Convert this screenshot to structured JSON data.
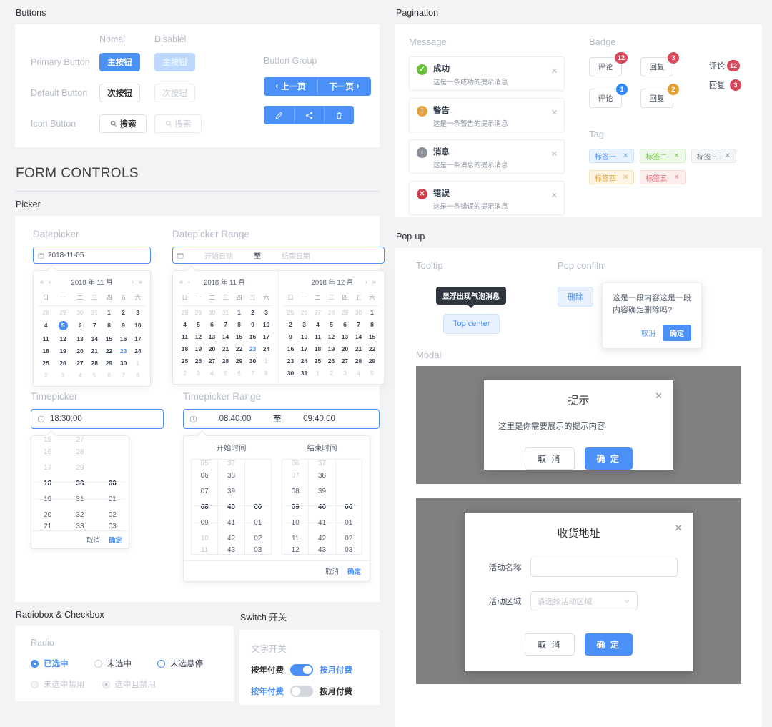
{
  "sections": {
    "buttons": "Buttons",
    "form_controls": "FORM CONTROLS",
    "picker": "Picker",
    "radio_checkbox": "Radiobox & Checkbox",
    "switch": "Switch 开关",
    "pagination": "Pagination",
    "popup": "Pop-up"
  },
  "buttons": {
    "col_normal": "Nomal",
    "col_disabled": "Disablel",
    "row_primary": "Primary Button",
    "row_default": "Default Button",
    "row_icon": "Icon Button",
    "primary_label": "主按钮",
    "default_label": "次按钮",
    "icon_label": "搜索",
    "group_title": "Button Group",
    "prev_page": "上一页",
    "next_page": "下一页",
    "icon_edit": "edit-icon",
    "icon_share": "share-icon",
    "icon_delete": "delete-icon"
  },
  "picker": {
    "datepicker_label": "Datepicker",
    "datepicker_value": "2018-11-05",
    "range_label": "Datepicker Range",
    "range_start_ph": "开始日期",
    "range_sep": "至",
    "range_end_ph": "结束日期",
    "cal_nov": "2018 年 11 月",
    "cal_dec": "2018 年 12 月",
    "weekdays": [
      "日",
      "一",
      "二",
      "三",
      "四",
      "五",
      "六"
    ],
    "nov_weeks": [
      [
        {
          "d": "28",
          "s": "mut"
        },
        {
          "d": "29",
          "s": "mut"
        },
        {
          "d": "30",
          "s": "mut"
        },
        {
          "d": "31",
          "s": "mut"
        },
        {
          "d": "1",
          "s": ""
        },
        {
          "d": "2",
          "s": ""
        },
        {
          "d": "3",
          "s": ""
        }
      ],
      [
        {
          "d": "4",
          "s": ""
        },
        {
          "d": "5",
          "s": "sel"
        },
        {
          "d": "6",
          "s": ""
        },
        {
          "d": "7",
          "s": ""
        },
        {
          "d": "8",
          "s": ""
        },
        {
          "d": "9",
          "s": ""
        },
        {
          "d": "10",
          "s": ""
        }
      ],
      [
        {
          "d": "11",
          "s": ""
        },
        {
          "d": "12",
          "s": ""
        },
        {
          "d": "13",
          "s": ""
        },
        {
          "d": "14",
          "s": ""
        },
        {
          "d": "15",
          "s": ""
        },
        {
          "d": "16",
          "s": ""
        },
        {
          "d": "17",
          "s": ""
        }
      ],
      [
        {
          "d": "18",
          "s": ""
        },
        {
          "d": "19",
          "s": ""
        },
        {
          "d": "20",
          "s": ""
        },
        {
          "d": "21",
          "s": ""
        },
        {
          "d": "22",
          "s": ""
        },
        {
          "d": "23",
          "s": "today"
        },
        {
          "d": "24",
          "s": ""
        }
      ],
      [
        {
          "d": "25",
          "s": ""
        },
        {
          "d": "26",
          "s": ""
        },
        {
          "d": "27",
          "s": ""
        },
        {
          "d": "28",
          "s": ""
        },
        {
          "d": "29",
          "s": ""
        },
        {
          "d": "30",
          "s": ""
        },
        {
          "d": "1",
          "s": "mut"
        }
      ],
      [
        {
          "d": "2",
          "s": "mut"
        },
        {
          "d": "3",
          "s": "mut"
        },
        {
          "d": "4",
          "s": "mut"
        },
        {
          "d": "5",
          "s": "mut"
        },
        {
          "d": "6",
          "s": "mut"
        },
        {
          "d": "7",
          "s": "mut"
        },
        {
          "d": "8",
          "s": "mut"
        }
      ]
    ],
    "nov_range_weeks": [
      [
        {
          "d": "28",
          "s": "mut"
        },
        {
          "d": "29",
          "s": "mut"
        },
        {
          "d": "30",
          "s": "mut"
        },
        {
          "d": "31",
          "s": "mut"
        },
        {
          "d": "1",
          "s": ""
        },
        {
          "d": "2",
          "s": ""
        },
        {
          "d": "3",
          "s": ""
        }
      ],
      [
        {
          "d": "4",
          "s": ""
        },
        {
          "d": "5",
          "s": ""
        },
        {
          "d": "6",
          "s": ""
        },
        {
          "d": "7",
          "s": ""
        },
        {
          "d": "8",
          "s": ""
        },
        {
          "d": "9",
          "s": ""
        },
        {
          "d": "10",
          "s": ""
        }
      ],
      [
        {
          "d": "11",
          "s": ""
        },
        {
          "d": "12",
          "s": ""
        },
        {
          "d": "13",
          "s": ""
        },
        {
          "d": "14",
          "s": ""
        },
        {
          "d": "15",
          "s": ""
        },
        {
          "d": "16",
          "s": ""
        },
        {
          "d": "17",
          "s": ""
        }
      ],
      [
        {
          "d": "18",
          "s": ""
        },
        {
          "d": "19",
          "s": ""
        },
        {
          "d": "20",
          "s": ""
        },
        {
          "d": "21",
          "s": ""
        },
        {
          "d": "22",
          "s": ""
        },
        {
          "d": "23",
          "s": "today"
        },
        {
          "d": "24",
          "s": ""
        }
      ],
      [
        {
          "d": "25",
          "s": ""
        },
        {
          "d": "26",
          "s": ""
        },
        {
          "d": "27",
          "s": ""
        },
        {
          "d": "28",
          "s": ""
        },
        {
          "d": "29",
          "s": ""
        },
        {
          "d": "30",
          "s": ""
        },
        {
          "d": "1",
          "s": "mut"
        }
      ],
      [
        {
          "d": "2",
          "s": "mut"
        },
        {
          "d": "3",
          "s": "mut"
        },
        {
          "d": "4",
          "s": "mut"
        },
        {
          "d": "5",
          "s": "mut"
        },
        {
          "d": "6",
          "s": "mut"
        },
        {
          "d": "7",
          "s": "mut"
        },
        {
          "d": "8",
          "s": "mut"
        }
      ]
    ],
    "dec_weeks": [
      [
        {
          "d": "25",
          "s": "mut"
        },
        {
          "d": "26",
          "s": "mut"
        },
        {
          "d": "27",
          "s": "mut"
        },
        {
          "d": "28",
          "s": "mut"
        },
        {
          "d": "29",
          "s": "mut"
        },
        {
          "d": "30",
          "s": "mut"
        },
        {
          "d": "1",
          "s": ""
        }
      ],
      [
        {
          "d": "2",
          "s": ""
        },
        {
          "d": "3",
          "s": ""
        },
        {
          "d": "4",
          "s": ""
        },
        {
          "d": "5",
          "s": ""
        },
        {
          "d": "6",
          "s": ""
        },
        {
          "d": "7",
          "s": ""
        },
        {
          "d": "8",
          "s": ""
        }
      ],
      [
        {
          "d": "9",
          "s": ""
        },
        {
          "d": "10",
          "s": ""
        },
        {
          "d": "11",
          "s": ""
        },
        {
          "d": "12",
          "s": ""
        },
        {
          "d": "13",
          "s": ""
        },
        {
          "d": "14",
          "s": ""
        },
        {
          "d": "15",
          "s": ""
        }
      ],
      [
        {
          "d": "16",
          "s": ""
        },
        {
          "d": "17",
          "s": ""
        },
        {
          "d": "18",
          "s": ""
        },
        {
          "d": "19",
          "s": ""
        },
        {
          "d": "20",
          "s": ""
        },
        {
          "d": "21",
          "s": ""
        },
        {
          "d": "22",
          "s": ""
        }
      ],
      [
        {
          "d": "23",
          "s": ""
        },
        {
          "d": "24",
          "s": ""
        },
        {
          "d": "25",
          "s": ""
        },
        {
          "d": "26",
          "s": ""
        },
        {
          "d": "27",
          "s": ""
        },
        {
          "d": "28",
          "s": ""
        },
        {
          "d": "29",
          "s": ""
        }
      ],
      [
        {
          "d": "30",
          "s": ""
        },
        {
          "d": "31",
          "s": ""
        },
        {
          "d": "1",
          "s": "mut"
        },
        {
          "d": "2",
          "s": "mut"
        },
        {
          "d": "3",
          "s": "mut"
        },
        {
          "d": "4",
          "s": "mut"
        },
        {
          "d": "5",
          "s": "mut"
        }
      ]
    ],
    "timepicker_label": "Timepicker",
    "timepicker_value": "18:30:00",
    "time_hours": [
      {
        "v": "15",
        "s": "mut part"
      },
      {
        "v": "16",
        "s": "mut"
      },
      {
        "v": "17",
        "s": "mut"
      },
      {
        "v": "18",
        "s": "cur"
      },
      {
        "v": "19",
        "s": ""
      },
      {
        "v": "20",
        "s": ""
      },
      {
        "v": "21",
        "s": "part"
      }
    ],
    "time_minutes": [
      {
        "v": "27",
        "s": "mut part"
      },
      {
        "v": "28",
        "s": "mut"
      },
      {
        "v": "29",
        "s": "mut"
      },
      {
        "v": "30",
        "s": "cur"
      },
      {
        "v": "31",
        "s": ""
      },
      {
        "v": "32",
        "s": ""
      },
      {
        "v": "33",
        "s": "part"
      }
    ],
    "time_seconds": [
      {
        "v": "",
        "s": "part"
      },
      {
        "v": "",
        "s": ""
      },
      {
        "v": "",
        "s": ""
      },
      {
        "v": "00",
        "s": "cur"
      },
      {
        "v": "01",
        "s": ""
      },
      {
        "v": "02",
        "s": ""
      },
      {
        "v": "03",
        "s": "part"
      }
    ],
    "cancel": "取消",
    "confirm": "确定",
    "timerange_label": "Timepicker Range",
    "timerange_start": "08:40:00",
    "timerange_sep": "至",
    "timerange_end": "09:40:00",
    "start_time_title": "开始时间",
    "end_time_title": "结束时间",
    "start_hours": [
      {
        "v": "05",
        "s": "mut part"
      },
      {
        "v": "06",
        "s": ""
      },
      {
        "v": "07",
        "s": ""
      },
      {
        "v": "08",
        "s": "cur"
      },
      {
        "v": "09",
        "s": ""
      },
      {
        "v": "10",
        "s": "mut"
      },
      {
        "v": "11",
        "s": "mut part"
      }
    ],
    "start_minutes": [
      {
        "v": "37",
        "s": "mut part"
      },
      {
        "v": "38",
        "s": ""
      },
      {
        "v": "39",
        "s": ""
      },
      {
        "v": "40",
        "s": "cur"
      },
      {
        "v": "41",
        "s": ""
      },
      {
        "v": "42",
        "s": ""
      },
      {
        "v": "43",
        "s": "part"
      }
    ],
    "start_seconds": [
      {
        "v": "",
        "s": "part"
      },
      {
        "v": "",
        "s": ""
      },
      {
        "v": "",
        "s": ""
      },
      {
        "v": "00",
        "s": "cur"
      },
      {
        "v": "01",
        "s": ""
      },
      {
        "v": "02",
        "s": ""
      },
      {
        "v": "03",
        "s": "part"
      }
    ],
    "end_hours": [
      {
        "v": "06",
        "s": "mut part"
      },
      {
        "v": "07",
        "s": "mut"
      },
      {
        "v": "08",
        "s": ""
      },
      {
        "v": "09",
        "s": "cur"
      },
      {
        "v": "10",
        "s": ""
      },
      {
        "v": "11",
        "s": ""
      },
      {
        "v": "12",
        "s": "part"
      }
    ],
    "end_minutes": [
      {
        "v": "37",
        "s": "mut part"
      },
      {
        "v": "38",
        "s": ""
      },
      {
        "v": "39",
        "s": ""
      },
      {
        "v": "40",
        "s": "cur"
      },
      {
        "v": "41",
        "s": ""
      },
      {
        "v": "42",
        "s": ""
      },
      {
        "v": "43",
        "s": "part"
      }
    ],
    "end_seconds": [
      {
        "v": "",
        "s": "part"
      },
      {
        "v": "",
        "s": ""
      },
      {
        "v": "",
        "s": ""
      },
      {
        "v": "00",
        "s": "cur"
      },
      {
        "v": "01",
        "s": ""
      },
      {
        "v": "02",
        "s": ""
      },
      {
        "v": "03",
        "s": "part"
      }
    ]
  },
  "radio": {
    "title": "Radio",
    "options": [
      {
        "label": "已选中",
        "state": "checked"
      },
      {
        "label": "未选中",
        "state": "unchecked"
      },
      {
        "label": "未选悬停",
        "state": "hover"
      },
      {
        "label": "未选中禁用",
        "state": "disabled"
      },
      {
        "label": "选中且禁用",
        "state": "disabled-checked"
      }
    ]
  },
  "switches": {
    "title": "文字开关",
    "items": [
      {
        "left": "按年付费",
        "right": "按月付费",
        "on": true
      },
      {
        "left": "按年付费",
        "right": "按月付费",
        "on": false
      }
    ]
  },
  "message": {
    "title": "Message",
    "items": [
      {
        "type": "success",
        "title": "成功",
        "desc": "这是一条成功的提示消息",
        "color": "#67c23a",
        "glyph": "✓"
      },
      {
        "type": "warning",
        "title": "警告",
        "desc": "这是一条警告的提示消息",
        "color": "#e6a23c",
        "glyph": "!"
      },
      {
        "type": "info",
        "title": "消息",
        "desc": "这是一条消息的提示消息",
        "color": "#8a8f99",
        "glyph": "i"
      },
      {
        "type": "error",
        "title": "错误",
        "desc": "这是一条错误的提示消息",
        "color": "#d73b4a",
        "glyph": "✕"
      }
    ]
  },
  "badge": {
    "title": "Badge",
    "buttons": [
      {
        "label": "评论",
        "count": "12",
        "color": "#d9485b"
      },
      {
        "label": "回复",
        "count": "3",
        "color": "#d9485b"
      },
      {
        "label": "评论",
        "count": "1",
        "color": "#2f86f6"
      },
      {
        "label": "回复",
        "count": "2",
        "color": "#e0a033"
      }
    ],
    "texts": [
      {
        "label": "评论",
        "count": "12",
        "color": "#d9485b"
      },
      {
        "label": "回复",
        "count": "3",
        "color": "#d9485b"
      }
    ]
  },
  "tag": {
    "title": "Tag",
    "items": [
      {
        "label": "标签一",
        "bg": "#e8f2fe",
        "border": "#c9e0fb",
        "fg": "#4a90f7"
      },
      {
        "label": "标签二",
        "bg": "#eef8ea",
        "border": "#d3ecca",
        "fg": "#67c23a"
      },
      {
        "label": "标签三",
        "bg": "#f4f5f7",
        "border": "#e2e5ea",
        "fg": "#70757e"
      },
      {
        "label": "标签四",
        "bg": "#fdf4e4",
        "border": "#f5e2bd",
        "fg": "#e6a23c"
      },
      {
        "label": "标签五",
        "bg": "#fdeeee",
        "border": "#f8d6d6",
        "fg": "#e4606d"
      }
    ]
  },
  "popup": {
    "tooltip_title": "Tooltip",
    "tooltip_text": "显浮出现气泡消息",
    "tooltip_button": "Top center",
    "popconfirm_title": "Pop confilm",
    "popconfirm_button": "删除",
    "popconfirm_text": "这是一段内容这是一段内容确定删除吗?",
    "popconfirm_cancel": "取消",
    "popconfirm_ok": "确定",
    "modal_title": "Modal",
    "modal1": {
      "title": "提示",
      "body": "这里是你需要展示的提示内容",
      "cancel": "取 消",
      "ok": "确 定"
    },
    "modal2": {
      "title": "收货地址",
      "field1_label": "活动名称",
      "field1_value": "",
      "field2_label": "活动区域",
      "field2_placeholder": "请选择活动区域",
      "cancel": "取 消",
      "ok": "确 定"
    }
  },
  "colors": {
    "primary": "#4a90f7",
    "page_bg": "#f2f3f5"
  }
}
